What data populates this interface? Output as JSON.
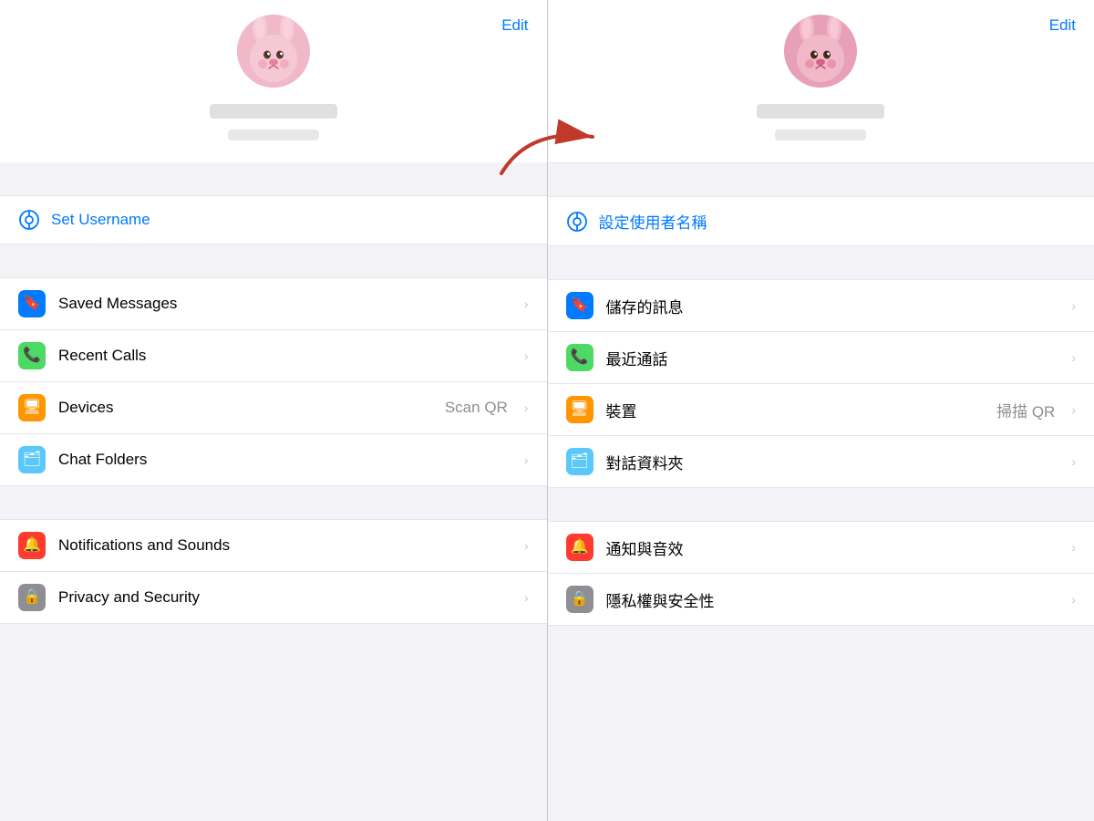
{
  "colors": {
    "blue": "#007aff",
    "green": "#4cd964",
    "orange": "#ff9500",
    "teal": "#5ac8fa",
    "red": "#ff3b30",
    "gray": "#8e8e93"
  },
  "left": {
    "edit": "Edit",
    "set_username": "Set Username",
    "items": [
      {
        "id": "saved-messages",
        "label": "Saved Messages",
        "icon": "bookmark",
        "icon_color": "blue",
        "secondary": "",
        "chevron": "›"
      },
      {
        "id": "recent-calls",
        "label": "Recent Calls",
        "icon": "phone",
        "icon_color": "green",
        "secondary": "",
        "chevron": "›"
      },
      {
        "id": "devices",
        "label": "Devices",
        "icon": "laptop",
        "icon_color": "orange",
        "secondary": "Scan QR",
        "chevron": "›"
      },
      {
        "id": "chat-folders",
        "label": "Chat Folders",
        "icon": "folder",
        "icon_color": "teal",
        "secondary": "",
        "chevron": "›"
      }
    ],
    "items2": [
      {
        "id": "notifications",
        "label": "Notifications and Sounds",
        "icon": "bell",
        "icon_color": "red",
        "secondary": "",
        "chevron": "›"
      },
      {
        "id": "privacy",
        "label": "Privacy and Security",
        "icon": "lock",
        "icon_color": "gray",
        "secondary": "",
        "chevron": "›"
      }
    ]
  },
  "right": {
    "edit": "Edit",
    "set_username": "設定使用者名稱",
    "items": [
      {
        "id": "saved-messages-zh",
        "label": "儲存的訊息",
        "icon": "bookmark",
        "icon_color": "blue",
        "secondary": "",
        "chevron": "›"
      },
      {
        "id": "recent-calls-zh",
        "label": "最近通話",
        "icon": "phone",
        "icon_color": "green",
        "secondary": "",
        "chevron": "›"
      },
      {
        "id": "devices-zh",
        "label": "裝置",
        "icon": "laptop",
        "icon_color": "orange",
        "secondary": "掃描 QR",
        "chevron": "›"
      },
      {
        "id": "chat-folders-zh",
        "label": "對話資料夾",
        "icon": "folder",
        "icon_color": "teal",
        "secondary": "",
        "chevron": "›"
      }
    ],
    "items2": [
      {
        "id": "notifications-zh",
        "label": "通知與音效",
        "icon": "bell",
        "icon_color": "red",
        "secondary": "",
        "chevron": "›"
      },
      {
        "id": "privacy-zh",
        "label": "隱私權與安全性",
        "icon": "lock",
        "icon_color": "gray",
        "secondary": "",
        "chevron": "›"
      }
    ]
  }
}
